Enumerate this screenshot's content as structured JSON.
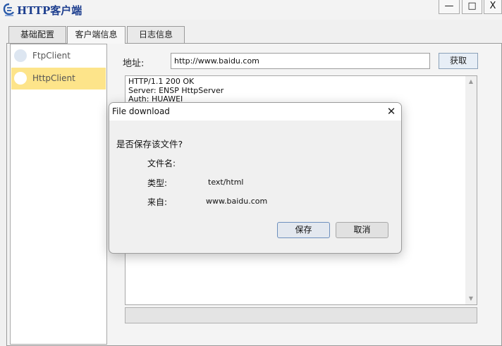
{
  "window": {
    "title": "HTTP客户端",
    "controls": {
      "minimize": "—",
      "maximize": "□",
      "close": "X"
    }
  },
  "tabs": [
    {
      "label": "基础配置"
    },
    {
      "label": "客户端信息",
      "active": true
    },
    {
      "label": "日志信息"
    }
  ],
  "clients": [
    {
      "label": "FtpClient",
      "selected": false
    },
    {
      "label": "HttpClient",
      "selected": true
    }
  ],
  "address": {
    "label": "地址:",
    "value": "http://www.baidu.com",
    "fetch_label": "获取"
  },
  "response": {
    "text": "HTTP/1.1 200 OK\nServer: ENSP HttpServer\nAuth: HUAWEI"
  },
  "dialog": {
    "title": "File download",
    "question": "是否保存该文件?",
    "filename_label": "文件名:",
    "type_label": "类型:",
    "type_value": "text/html",
    "from_label": "来自:",
    "from_value": "www.baidu.com",
    "save_label": "保存",
    "cancel_label": "取消"
  },
  "colors": {
    "selected_item": "#fde48a",
    "title_text": "#1e3f8f"
  }
}
